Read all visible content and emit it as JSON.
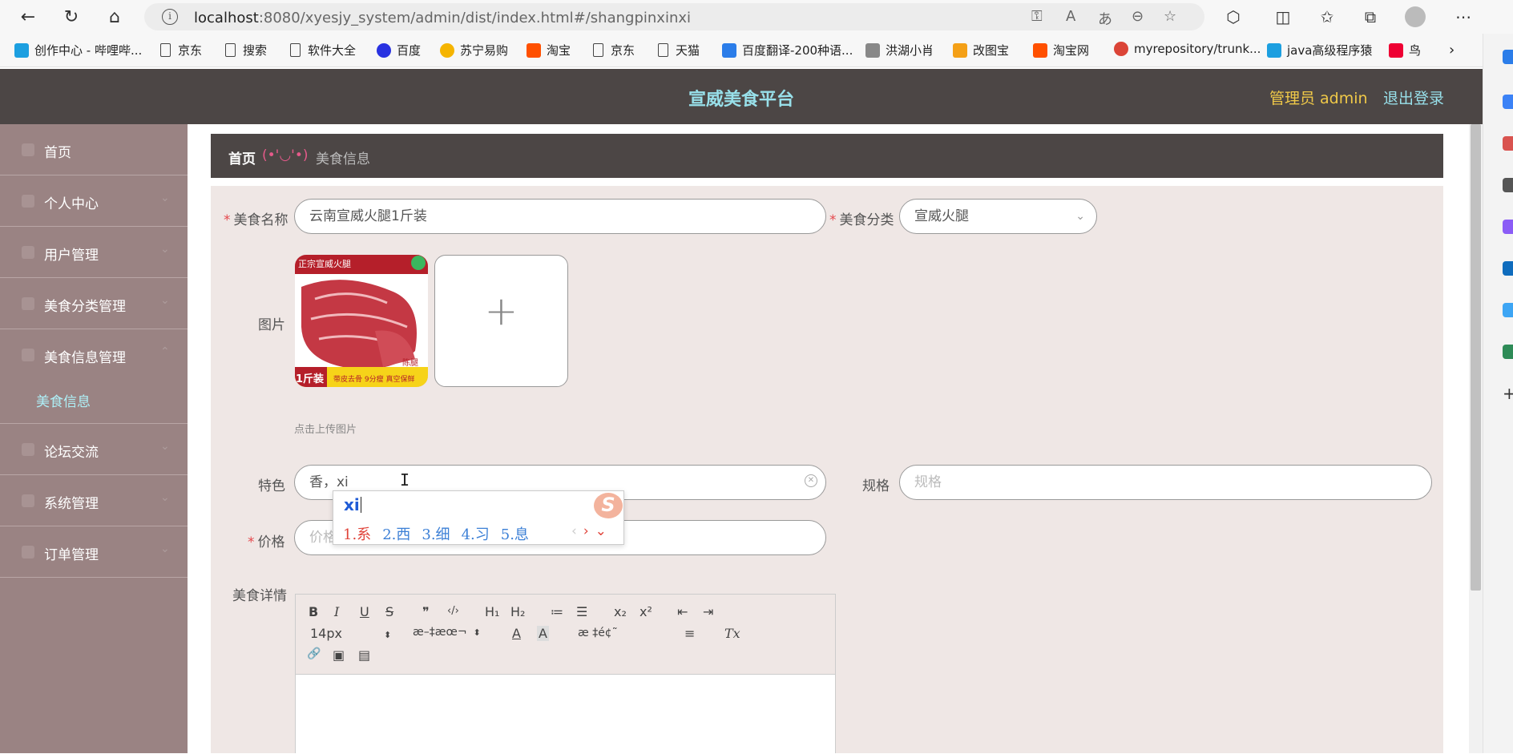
{
  "browser": {
    "url_host": "localhost",
    "url_path": ":8080/xyesjy_system/admin/dist/index.html#/shangpinxinxi",
    "info_icon": "i"
  },
  "bookmarks": [
    {
      "label": "创作中心 - 哔哩哔...",
      "icon": "bilibili-icon",
      "color": "#1c9fe0"
    },
    {
      "label": "京东",
      "icon": "doc-icon"
    },
    {
      "label": "搜索",
      "icon": "doc-icon"
    },
    {
      "label": "软件大全",
      "icon": "doc-icon"
    },
    {
      "label": "百度",
      "icon": "baidu-icon",
      "color": "#2932e1"
    },
    {
      "label": "苏宁易购",
      "icon": "suning-icon",
      "color": "#f5b400"
    },
    {
      "label": "淘宝",
      "icon": "taobao-icon",
      "color": "#ff5000"
    },
    {
      "label": "京东",
      "icon": "doc-icon"
    },
    {
      "label": "天猫",
      "icon": "doc-icon"
    },
    {
      "label": "百度翻译-200种语...",
      "icon": "translate-icon",
      "color": "#2b7de9"
    },
    {
      "label": "洪湖小肖",
      "icon": "hongqiao-icon",
      "color": "#888"
    },
    {
      "label": "改图宝",
      "icon": "gaitubao-icon",
      "color": "#f4a017"
    },
    {
      "label": "淘宝网",
      "icon": "taobao-icon",
      "color": "#ff5000"
    },
    {
      "label": "myrepository/trunk...",
      "icon": "chrome-icon",
      "color": "#db4437"
    },
    {
      "label": "java高级程序猿",
      "icon": "bilibili-icon",
      "color": "#1c9fe0"
    },
    {
      "label": "鸟",
      "icon": "bird-icon",
      "color": "#e03"
    }
  ],
  "header": {
    "title": "宣威美食平台",
    "admin": "管理员 admin",
    "logout": "退出登录"
  },
  "sidebar": {
    "items": [
      {
        "label": "首页"
      },
      {
        "label": "个人中心"
      },
      {
        "label": "用户管理"
      },
      {
        "label": "美食分类管理"
      },
      {
        "label": "美食信息管理"
      },
      {
        "label": "论坛交流"
      },
      {
        "label": "系统管理"
      },
      {
        "label": "订单管理"
      }
    ],
    "sub_item": "美食信息"
  },
  "breadcrumb": {
    "home": "首页",
    "separator": "(•'◡'•)",
    "current": "美食信息"
  },
  "form": {
    "name_label": "美食名称",
    "name_value": "云南宣威火腿1斤装",
    "category_label": "美食分类",
    "category_value": "宣威火腿",
    "image_label": "图片",
    "image_banner": "正宗宣威火腿",
    "image_tag": "1斤装",
    "image_bottom": "带皮去骨 9分瘦 真空保鲜",
    "image_side": "陈腿",
    "upload_plus": "+",
    "upload_tip": "点击上传图片",
    "feature_label": "特色",
    "feature_value": "香，xi",
    "spec_label": "规格",
    "spec_placeholder": "规格",
    "price_label": "价格",
    "price_placeholder": "价格",
    "detail_label": "美食详情"
  },
  "ime": {
    "composition": "xi",
    "logo": "S",
    "candidates": [
      "1.系",
      "2.西",
      "3.细",
      "4.习",
      "5.息"
    ],
    "prev": "‹",
    "next": "›",
    "expand": "⌄"
  },
  "editor": {
    "bold": "B",
    "italic": "I",
    "underline": "U",
    "strike": "S",
    "quote": "❞",
    "code": "‹/›",
    "h1": "H₁",
    "h2": "H₂",
    "ol": "≔",
    "ul": "☰",
    "sub": "x₂",
    "sup": "x²",
    "outdent": "⇤",
    "indent": "⇥",
    "font_size": "14px",
    "font_family": "æ–‡æœ¬",
    "color": "A",
    "background": "A",
    "header_select": "æ ‡é¢˜",
    "align": "≡",
    "clean": "Tx",
    "link": "🔗",
    "image": "▣",
    "video": "▤"
  }
}
